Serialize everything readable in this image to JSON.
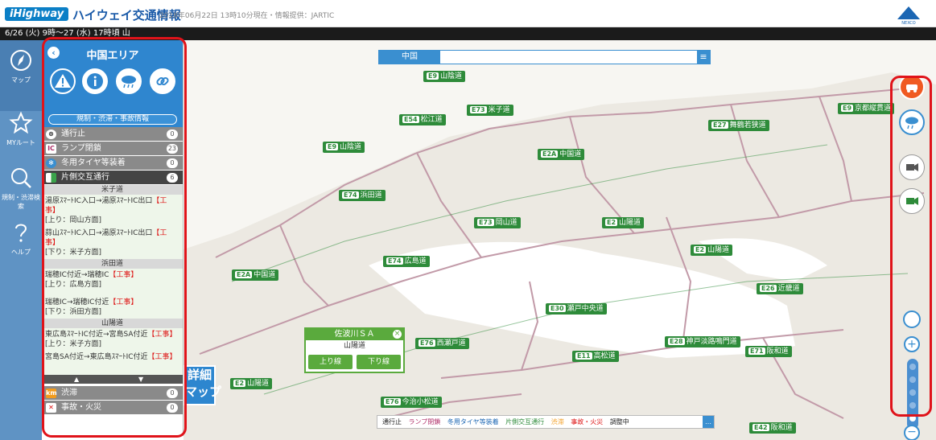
{
  "header": {
    "logo": "iHighway",
    "title": "ハイウェイ交通情報",
    "meta": "2018年06月22日 13時10分現在・情報提供：JARTIC",
    "ticker": "6/26 (火) 9時～27 (水) 17時頃 山"
  },
  "nav": {
    "items": [
      {
        "label": "マップ",
        "icon": "compass-icon"
      },
      {
        "label": "MYルート",
        "icon": "star-icon"
      },
      {
        "label": "規制・渋滞検索",
        "icon": "search-icon"
      },
      {
        "label": "ヘルプ",
        "icon": "help-icon"
      }
    ]
  },
  "panel": {
    "title": "中国エリア",
    "tab_label": "規制・渋滞・事故情報",
    "categories": [
      {
        "label": "通行止",
        "count": "0",
        "icon": "closure-icon"
      },
      {
        "label": "ランプ閉鎖",
        "count": "23",
        "icon": "ramp-closure-icon",
        "badge": "IC"
      },
      {
        "label": "冬用タイヤ等装着",
        "count": "0",
        "icon": "winter-tire-icon"
      },
      {
        "label": "片側交互通行",
        "count": "6",
        "icon": "alternating-traffic-icon"
      }
    ],
    "sections": [
      {
        "road": "米子道",
        "entries": [
          {
            "route": "湯原ｽﾏｰﾄIC入口→湯原ｽﾏｰﾄIC出口",
            "tag": "【工事】",
            "dir": "[上り：岡山方面]"
          },
          {
            "route": "蒜山ｽﾏｰﾄIC入口→湯原ｽﾏｰﾄIC出口",
            "tag": "【工事】",
            "dir": "[下り：米子方面]"
          }
        ]
      },
      {
        "road": "浜田道",
        "entries": [
          {
            "route": "瑞穂IC付近→瑞穂IC",
            "tag": "【工事】",
            "dir": "[上り：広島方面]"
          },
          {
            "route": "瑞穂IC→瑞穂IC付近",
            "tag": "【工事】",
            "dir": "[下り：浜田方面]"
          }
        ]
      },
      {
        "road": "山陽道",
        "entries": [
          {
            "route": "東広島ｽﾏｰﾄIC付近→宮島SA付近",
            "tag": "【工事】",
            "dir": "[上り：米子方面]"
          },
          {
            "route": "宮島SA付近→東広島ｽﾏｰﾄIC付近",
            "tag": "【工事】",
            "dir": ""
          }
        ]
      }
    ],
    "bottom": [
      {
        "label": "渋滞",
        "count": "0"
      },
      {
        "label": "事故・火災",
        "count": "0"
      }
    ]
  },
  "map": {
    "search_area": "中国",
    "routes": [
      {
        "code": "E9",
        "name": "山陰道"
      },
      {
        "code": "E73",
        "name": "米子道"
      },
      {
        "code": "E54",
        "name": "松江道"
      },
      {
        "code": "E2A",
        "name": "中国道"
      },
      {
        "code": "E27",
        "name": "舞鶴若狭道"
      },
      {
        "code": "E9",
        "name": "山陰道"
      },
      {
        "code": "E9",
        "name": "京都縦貫道"
      },
      {
        "code": "E74",
        "name": "浜田道"
      },
      {
        "code": "E73",
        "name": "岡山道"
      },
      {
        "code": "E2",
        "name": "山陽道"
      },
      {
        "code": "E2A",
        "name": "中国道"
      },
      {
        "code": "E74",
        "name": "広島道"
      },
      {
        "code": "E2",
        "name": "山陽道"
      },
      {
        "code": "E30",
        "name": "瀬戸中央道"
      },
      {
        "code": "E76",
        "name": "西瀬戸道"
      },
      {
        "code": "E11",
        "name": "高松道"
      },
      {
        "code": "E28",
        "name": "神戸淡路鳴門道"
      },
      {
        "code": "E26",
        "name": "近畿道"
      },
      {
        "code": "E71",
        "name": "阪和道"
      },
      {
        "code": "E76",
        "name": "今治小松道"
      },
      {
        "code": "E42",
        "name": "阪和道"
      },
      {
        "code": "E2",
        "name": "山陽道"
      }
    ],
    "popup": {
      "title": "佐波川ＳＡ",
      "subtitle": "山陽道",
      "btn1": "上り線",
      "btn2": "下り線",
      "close": "×"
    },
    "detail_button": "詳細\nマップ",
    "legend": [
      "通行止",
      "ランプ閉鎖",
      "冬用タイヤ等装着",
      "片側交互通行",
      "渋滞",
      "事故・火災",
      "調整中"
    ]
  },
  "colors": {
    "accent": "#2f86cf",
    "highlight": "#e0131a",
    "route": "#2e8b3a",
    "road_line": "#c29aa8"
  }
}
